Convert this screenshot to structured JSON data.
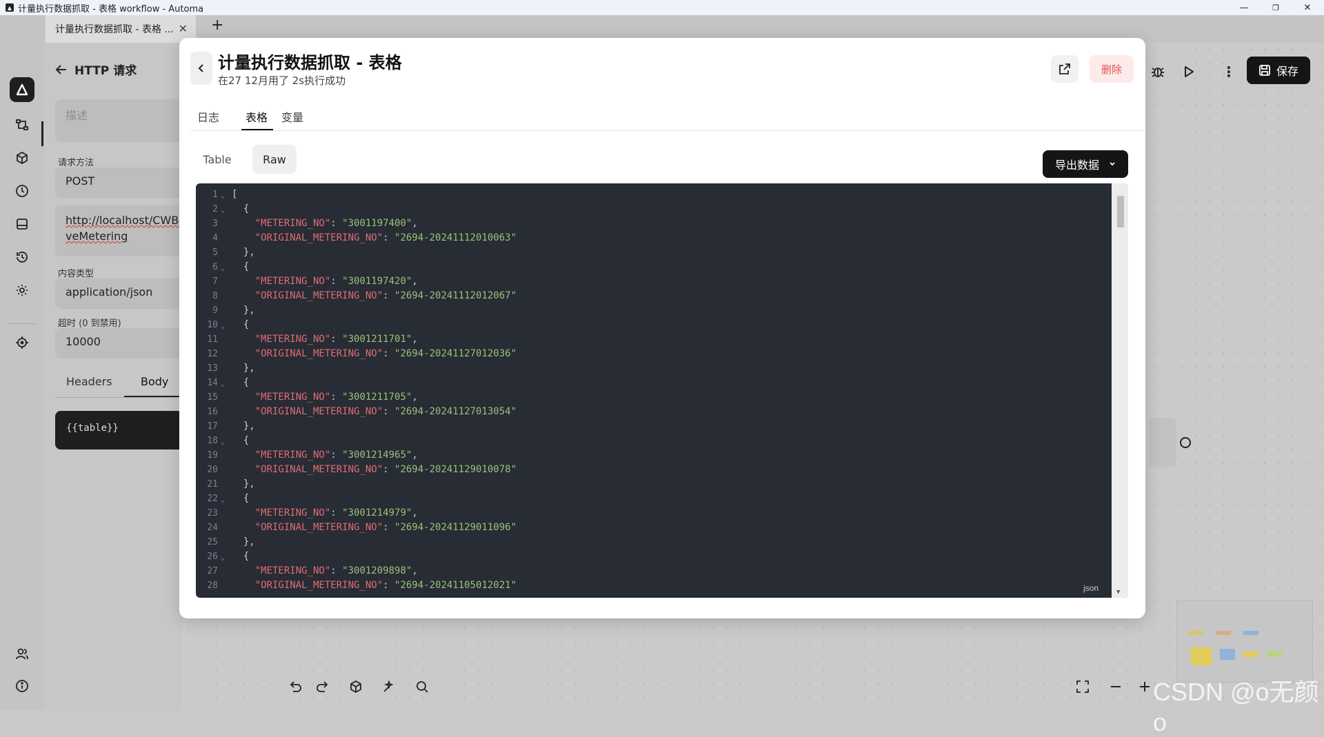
{
  "window": {
    "title": "计量执行数据抓取 - 表格 workflow - Automa",
    "tab_label": "计量执行数据抓取 - 表格 ...",
    "tab_close": "✕",
    "new_tab": "+",
    "controls": [
      "—",
      "❐",
      "✕"
    ]
  },
  "editor": {
    "back_label": "HTTP 请求",
    "description_placeholder": "描述",
    "method_label": "请求方法",
    "method_value": "POST",
    "url_line1": "http://localhost/CWBI",
    "url_line2": "veMetering",
    "content_type_label": "内容类型",
    "content_type_value": "application/json",
    "timeout_label": "超时 (0 到禁用)",
    "timeout_value": "10000",
    "tab_headers": "Headers",
    "tab_body": "Body",
    "body_value": "{{table}}"
  },
  "toolbar": {
    "save_label": "保存"
  },
  "modal": {
    "title": "计量执行数据抓取 - 表格",
    "subtitle": "在27 12月用了 2s执行成功",
    "delete_label": "删除",
    "tabs": [
      "日志",
      "表格",
      "变量"
    ],
    "active_tab": "表格",
    "view_table": "Table",
    "view_raw": "Raw",
    "export_label": "导出数据",
    "code_lang": "json"
  },
  "records": [
    {
      "metering_no": "3001197400",
      "original_metering_no": "2694-20241112010063"
    },
    {
      "metering_no": "3001197420",
      "original_metering_no": "2694-20241112012067"
    },
    {
      "metering_no": "3001211701",
      "original_metering_no": "2694-20241127012036"
    },
    {
      "metering_no": "3001211705",
      "original_metering_no": "2694-20241127013054"
    },
    {
      "metering_no": "3001214965",
      "original_metering_no": "2694-20241129010078"
    },
    {
      "metering_no": "3001214979",
      "original_metering_no": "2694-20241129011096"
    },
    {
      "metering_no": "3001209898",
      "original_metering_no": "2694-20241105012021"
    }
  ],
  "watermark": "CSDN @o无颜o",
  "colors": {
    "accent_dark": "#151515",
    "danger": "#e25555",
    "code_bg": "#282c34",
    "json_key": "#e06c75",
    "json_string": "#98c379"
  }
}
